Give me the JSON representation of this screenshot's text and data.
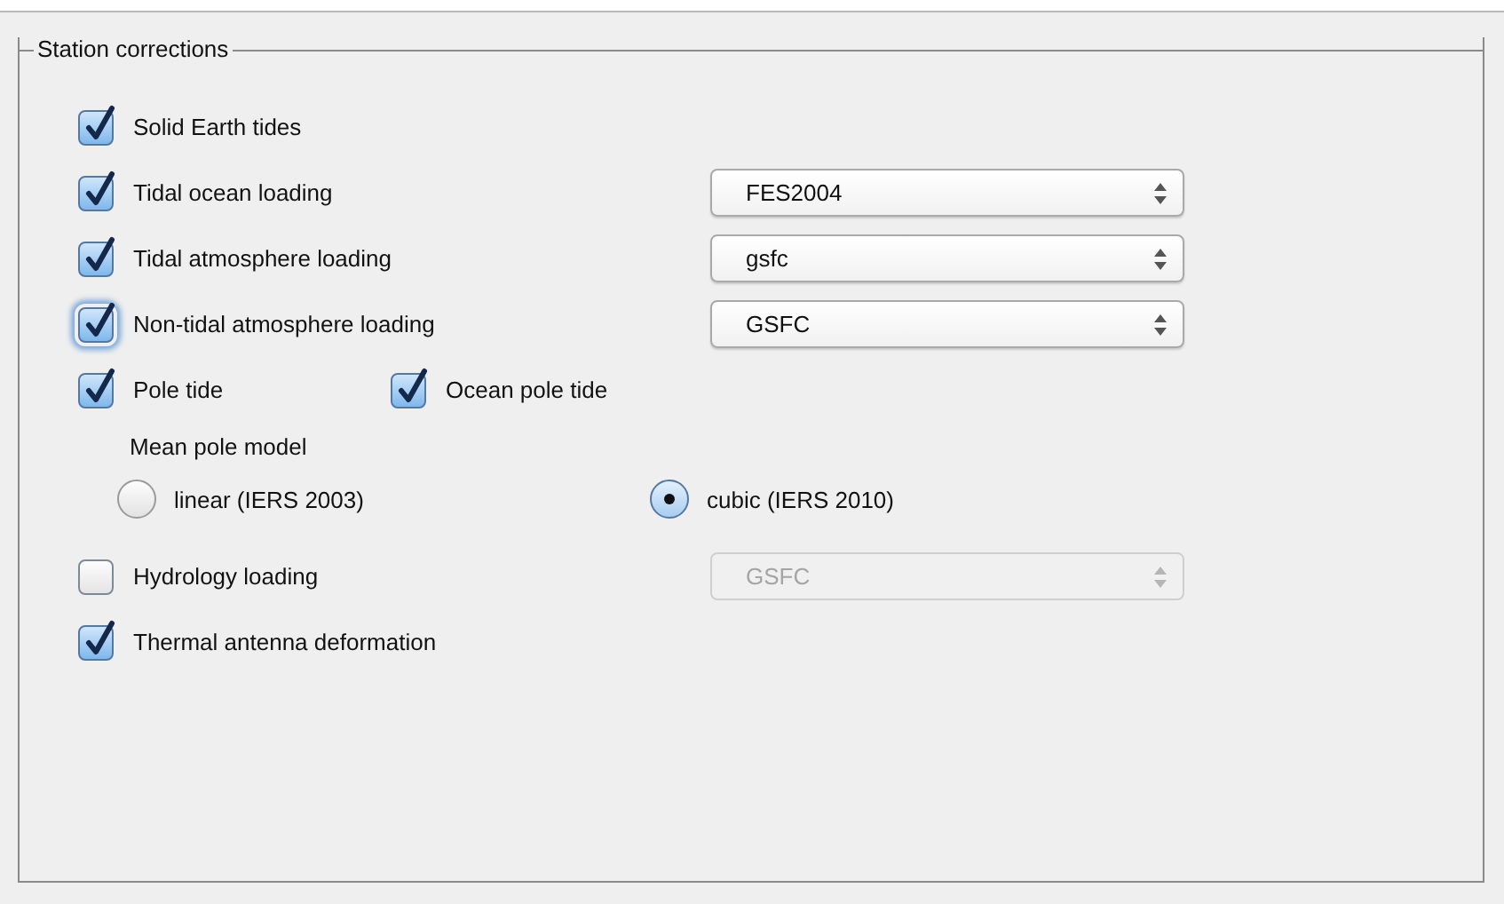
{
  "group": {
    "title": "Station corrections",
    "rows": [
      {
        "kind": "check",
        "label": "Solid Earth tides",
        "checked": true,
        "focused": false
      },
      {
        "kind": "check",
        "label": "Tidal ocean loading",
        "checked": true,
        "focused": false,
        "select": {
          "value": "FES2004",
          "disabled": false
        }
      },
      {
        "kind": "check",
        "label": "Tidal atmosphere loading",
        "checked": true,
        "focused": false,
        "select": {
          "value": "gsfc",
          "disabled": false
        }
      },
      {
        "kind": "check",
        "label": "Non-tidal atmosphere loading",
        "checked": true,
        "focused": true,
        "select": {
          "value": "GSFC",
          "disabled": false
        }
      },
      {
        "kind": "pair",
        "items": [
          {
            "label": "Pole tide",
            "checked": true,
            "focused": false
          },
          {
            "label": "Ocean pole tide",
            "checked": true,
            "focused": false
          }
        ]
      },
      {
        "kind": "caption",
        "label": "Mean pole model"
      },
      {
        "kind": "radios",
        "options": [
          {
            "label": "linear (IERS 2003)",
            "selected": false
          },
          {
            "label": "cubic (IERS 2010)",
            "selected": true
          }
        ]
      },
      {
        "kind": "check",
        "label": "Hydrology loading",
        "checked": false,
        "focused": false,
        "select": {
          "value": "GSFC",
          "disabled": true
        }
      },
      {
        "kind": "check",
        "label": "Thermal antenna deformation",
        "checked": true,
        "focused": false
      }
    ]
  }
}
